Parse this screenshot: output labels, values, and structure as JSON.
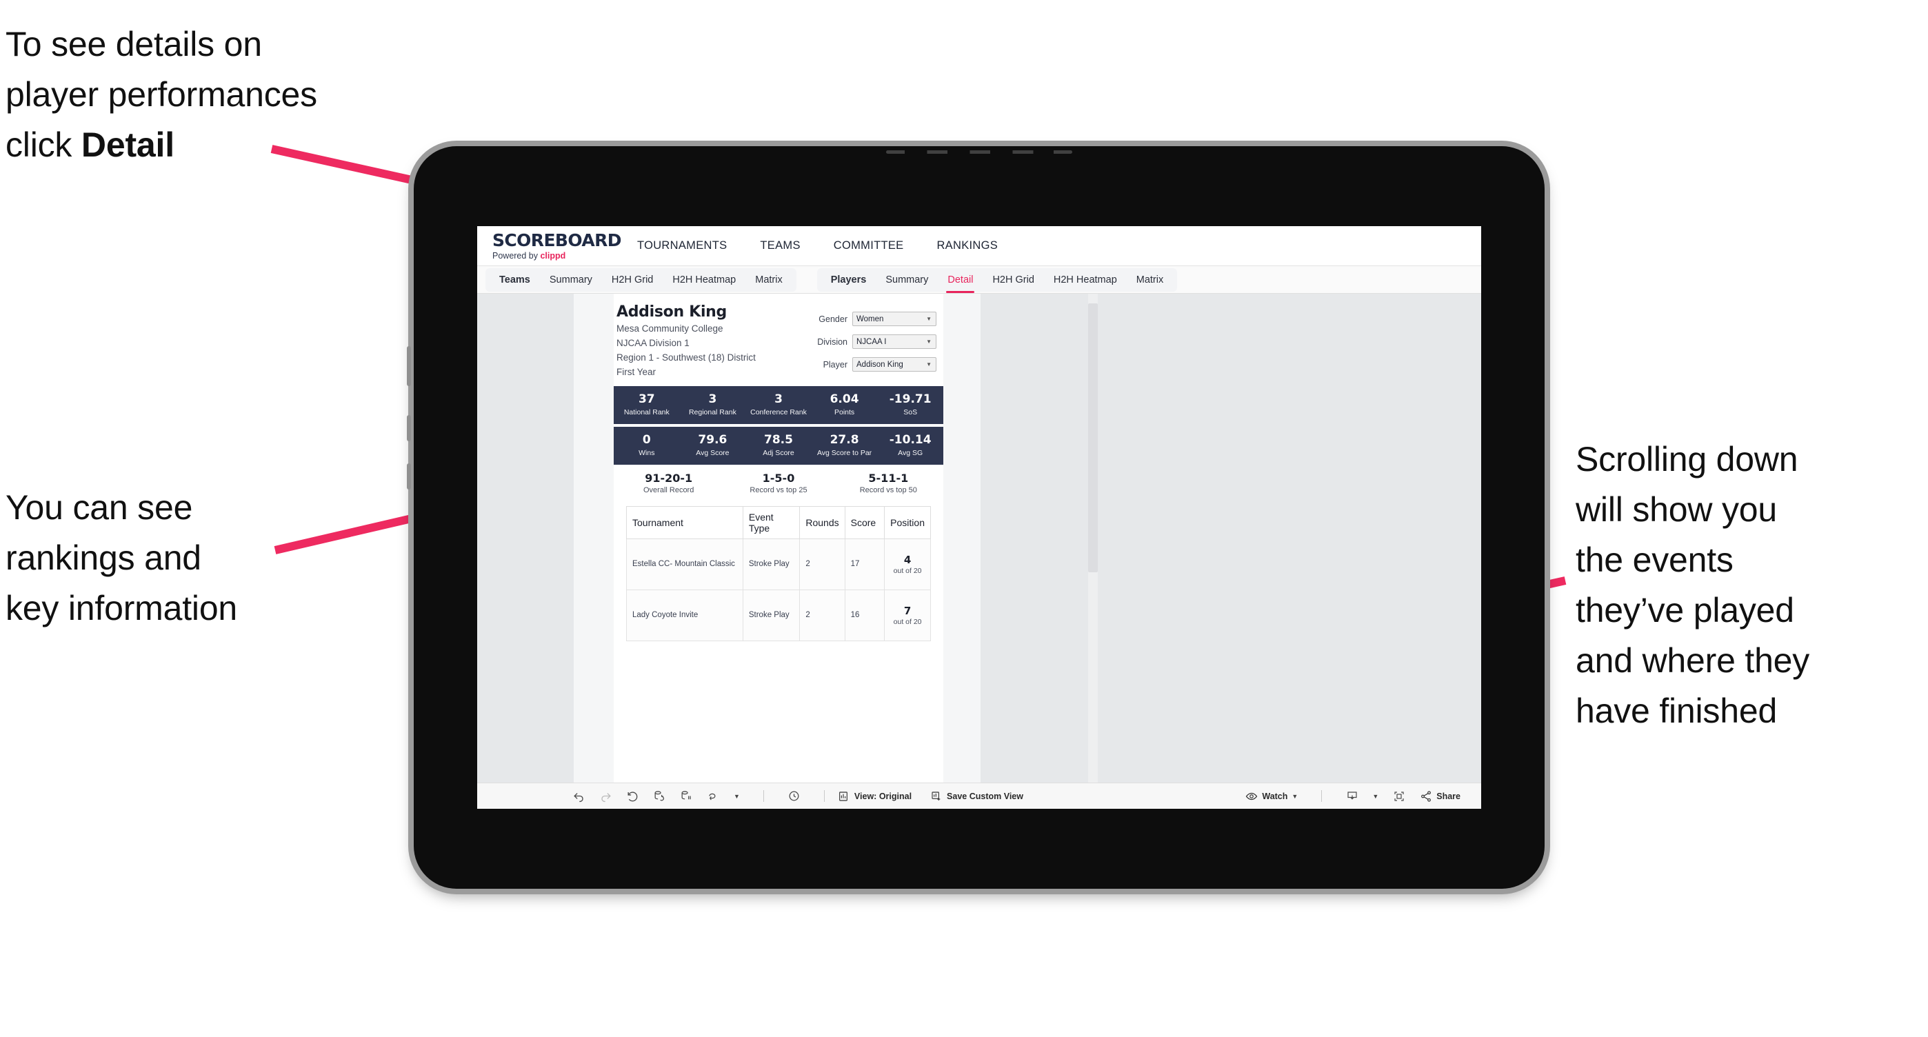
{
  "annotations": {
    "top_left": "To see details on\nplayer performances\nclick ",
    "top_left_bold": "Detail",
    "left": "You can see\nrankings and\nkey information",
    "right": "Scrolling down\nwill show you\nthe events\nthey’ve played\nand where they\nhave finished",
    "arrow_color": "#ee2a60"
  },
  "app": {
    "brand": {
      "title": "SCOREBOARD",
      "powered_prefix": "Powered by ",
      "powered_name": "clippd"
    },
    "topnav": [
      "TOURNAMENTS",
      "TEAMS",
      "COMMITTEE",
      "RANKINGS"
    ],
    "tabs_group_1": [
      "Teams",
      "Summary",
      "H2H Grid",
      "H2H Heatmap",
      "Matrix"
    ],
    "tabs_group_2": [
      "Players",
      "Summary",
      "Detail",
      "H2H Grid",
      "H2H Heatmap",
      "Matrix"
    ],
    "active_tab": "Detail"
  },
  "player": {
    "name": "Addison King",
    "school": "Mesa Community College",
    "division": "NJCAA Division 1",
    "region": "Region 1 - Southwest (18) District",
    "year": "First Year"
  },
  "filters": [
    {
      "label": "Gender",
      "value": "Women"
    },
    {
      "label": "Division",
      "value": "NJCAA I"
    },
    {
      "label": "Player",
      "value": "Addison King"
    }
  ],
  "stats_row_1": [
    {
      "value": "37",
      "label": "National Rank"
    },
    {
      "value": "3",
      "label": "Regional Rank"
    },
    {
      "value": "3",
      "label": "Conference Rank"
    },
    {
      "value": "6.04",
      "label": "Points"
    },
    {
      "value": "-19.71",
      "label": "SoS"
    }
  ],
  "stats_row_2": [
    {
      "value": "0",
      "label": "Wins"
    },
    {
      "value": "79.6",
      "label": "Avg Score"
    },
    {
      "value": "78.5",
      "label": "Adj Score"
    },
    {
      "value": "27.8",
      "label": "Avg Score to Par"
    },
    {
      "value": "-10.14",
      "label": "Avg SG"
    }
  ],
  "records": [
    {
      "value": "91-20-1",
      "label": "Overall Record"
    },
    {
      "value": "1-5-0",
      "label": "Record vs top 25"
    },
    {
      "value": "5-11-1",
      "label": "Record vs top 50"
    }
  ],
  "table": {
    "headers": [
      "Tournament",
      "Event Type",
      "Rounds",
      "Score",
      "Position"
    ],
    "rows": [
      {
        "tournament": "Estella CC- Mountain Classic",
        "event_type": "Stroke Play",
        "rounds": "2",
        "score": "17",
        "position_num": "4",
        "position_of": "out of 20"
      },
      {
        "tournament": "Lady Coyote Invite",
        "event_type": "Stroke Play",
        "rounds": "2",
        "score": "16",
        "position_num": "7",
        "position_of": "out of 20"
      }
    ]
  },
  "toolbar": {
    "view_label": "View: Original",
    "save_label": "Save Custom View",
    "watch_label": "Watch",
    "share_label": "Share"
  },
  "colors": {
    "accent_pink": "#e8245c",
    "stat_navy": "#2f3751",
    "screen_bg": "#e6e8ea"
  }
}
